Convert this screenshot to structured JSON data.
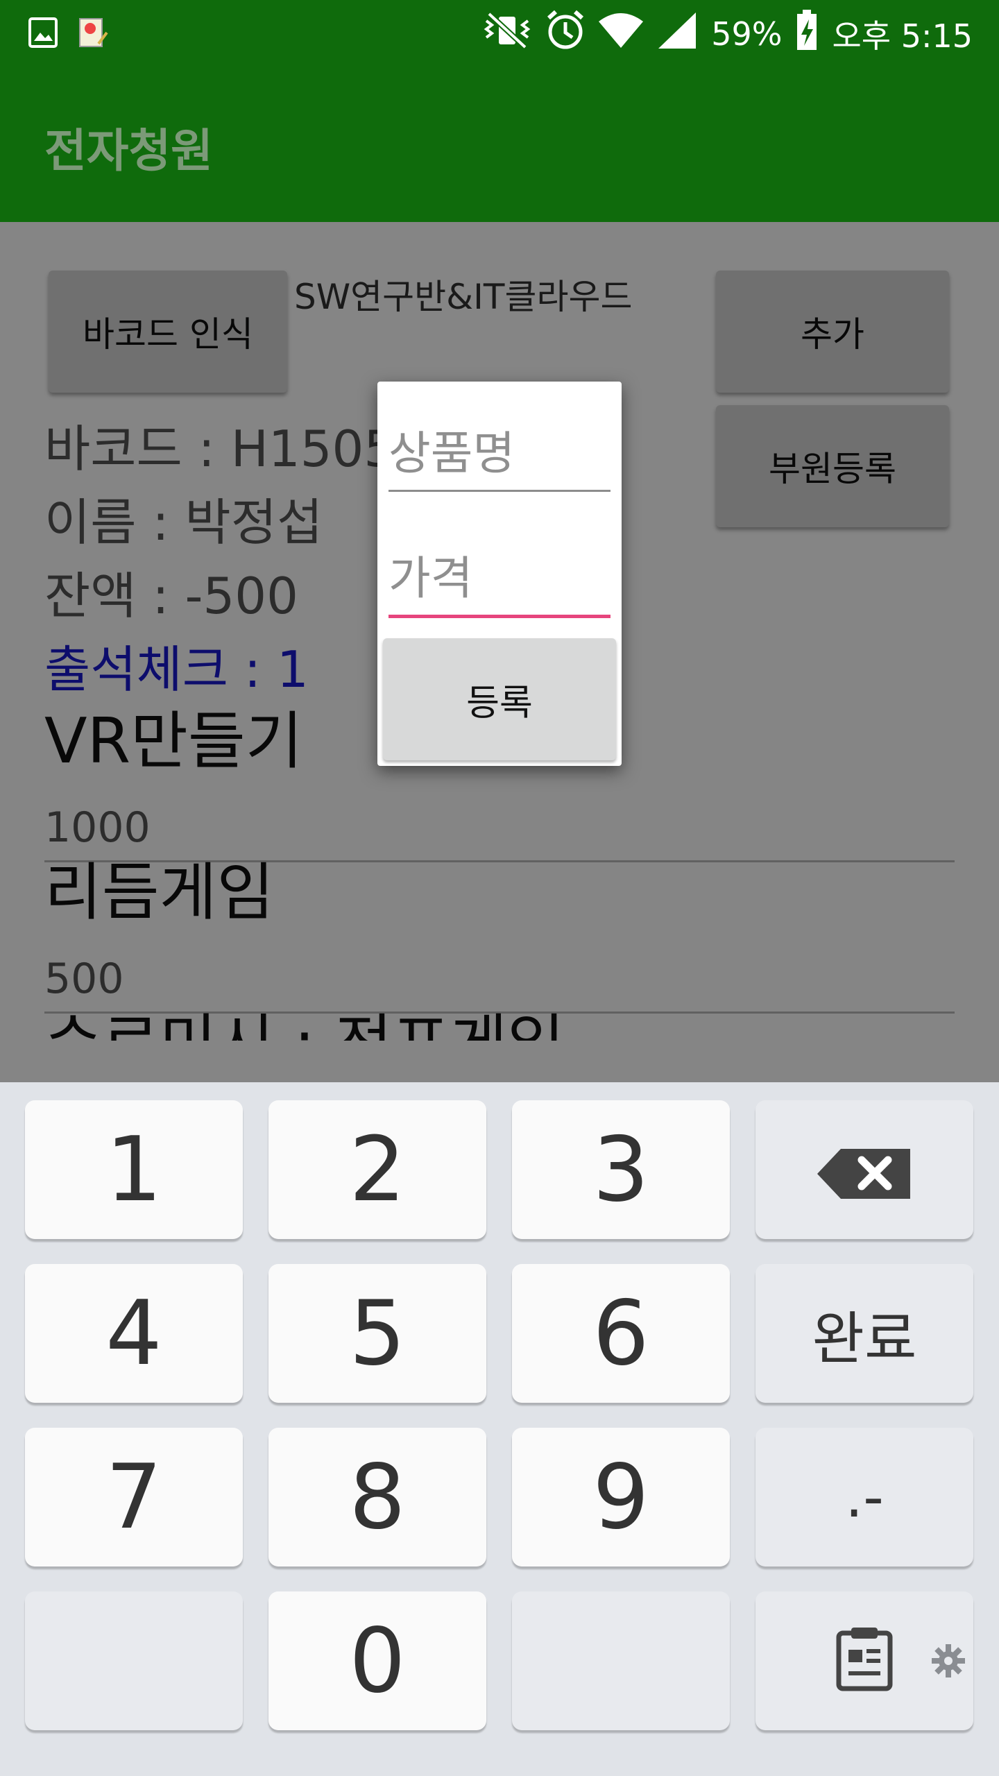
{
  "status_bar": {
    "icons_left": [
      "image-icon",
      "notification-app-icon"
    ],
    "icons_right": [
      "vibrate-mute-icon",
      "alarm-icon",
      "wifi-icon",
      "signal-icon"
    ],
    "battery": "59%",
    "time": "오후 5:15"
  },
  "app_bar": {
    "title": "전자청원"
  },
  "main": {
    "barcode_button": "바코드 인식",
    "header_text": "SW연구반&IT클라우드",
    "add_button": "추가",
    "register_member_button": "부원등록",
    "barcode_line": "바코드 : H1505",
    "name_line": "이름 : 박정섭",
    "balance_line": "잔액 : -500",
    "attendance_line": "출석체크 : 1",
    "items": [
      {
        "name": "VR만들기",
        "price": "1000"
      },
      {
        "name": "리듬게임",
        "price": "500"
      },
      {
        "name": "수르미시 : 전포게임",
        "price": ""
      }
    ]
  },
  "dialog": {
    "product_name_placeholder": "상품명",
    "price_placeholder": "가격",
    "register_button": "등록"
  },
  "keyboard": {
    "keys": [
      "1",
      "2",
      "3",
      "4",
      "5",
      "6",
      "7",
      "8",
      "9",
      "0"
    ],
    "done_label": "완료",
    "punct_label": ".-",
    "icons": [
      "backspace-icon",
      "clipboard-icon",
      "gear-icon"
    ]
  },
  "colors": {
    "app_bar": "#0f6b0c",
    "accent": "#e6457d",
    "attendance_text": "#1a1ad0",
    "keyboard_bg": "#e0e3e8"
  }
}
